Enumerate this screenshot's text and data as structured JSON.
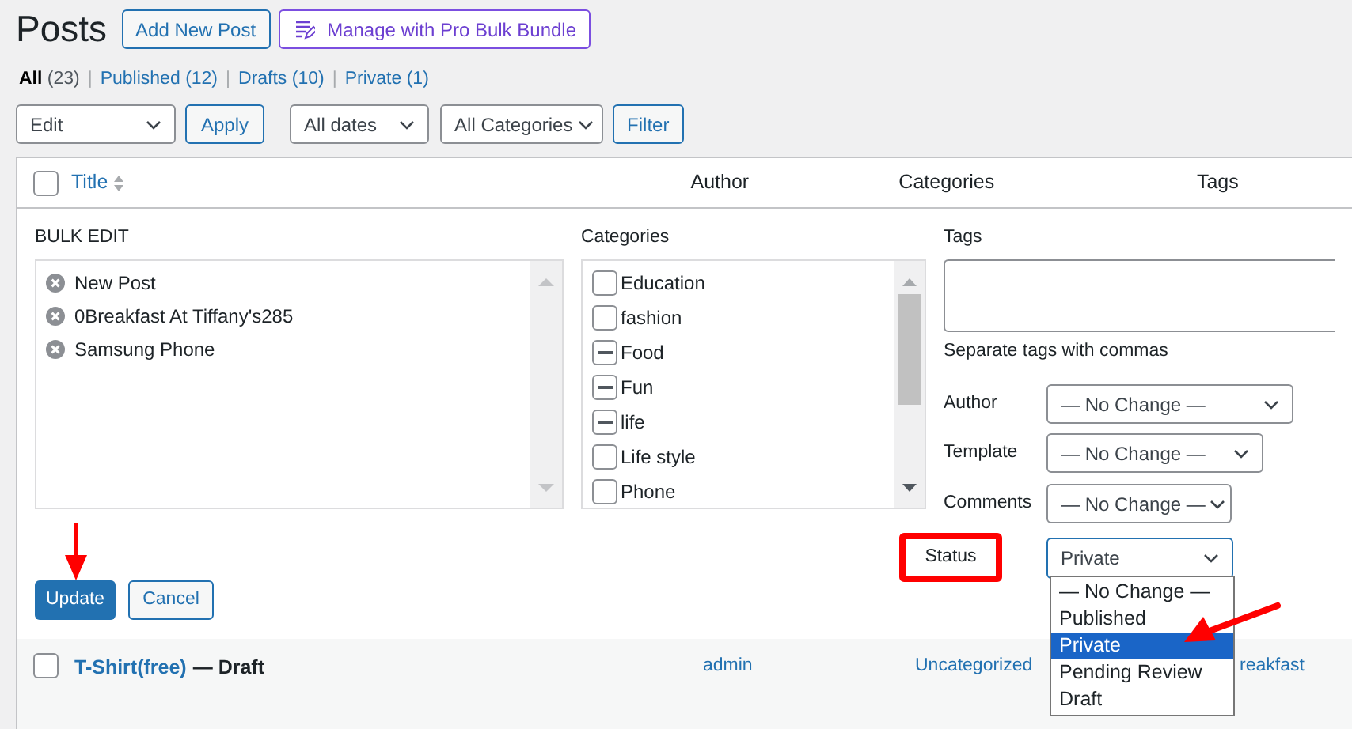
{
  "header": {
    "title": "Posts",
    "buttons": [
      {
        "label": "Add New Post",
        "kind": "default"
      },
      {
        "label": "Manage with Pro Bulk Bundle",
        "kind": "pro"
      }
    ]
  },
  "views": [
    {
      "label": "All",
      "count": "(23)",
      "selected": true
    },
    {
      "label": "Published",
      "count": "(12)",
      "selected": false
    },
    {
      "label": "Drafts",
      "count": "(10)",
      "selected": false
    },
    {
      "label": "Private",
      "count": "(1)",
      "selected": false
    }
  ],
  "view_separator": "|",
  "toolbar": {
    "bulk_action": "Edit",
    "apply": "Apply",
    "dates": "All dates",
    "categories": "All Categories",
    "filter": "Filter"
  },
  "table": {
    "select_all_checked": false,
    "columns": [
      "Title",
      "Author",
      "Categories",
      "Tags"
    ],
    "bulk_edit": {
      "heading": "BULK EDIT",
      "posts": [
        "New Post",
        "0Breakfast At Tiffany's285",
        "Samsung Phone"
      ],
      "categories_label": "Categories",
      "categories": [
        {
          "label": "Education",
          "indeterminate": false
        },
        {
          "label": "fashion",
          "indeterminate": false
        },
        {
          "label": "Food",
          "indeterminate": true
        },
        {
          "label": "Fun",
          "indeterminate": true
        },
        {
          "label": "life",
          "indeterminate": true
        },
        {
          "label": "Life style",
          "indeterminate": false
        },
        {
          "label": "Phone",
          "indeterminate": false
        }
      ],
      "tags_label": "Tags",
      "tags_hint": "Separate tags with commas",
      "fields": [
        {
          "label": "Author",
          "value": "— No Change —",
          "expanded": false
        },
        {
          "label": "Template",
          "value": "— No Change —",
          "expanded": false
        },
        {
          "label": "Comments",
          "value": "— No Change —",
          "expanded": false
        },
        {
          "label": "Status",
          "value": "Private",
          "expanded": true,
          "options": [
            {
              "label": "— No Change —",
              "selected": false
            },
            {
              "label": "Published",
              "selected": false
            },
            {
              "label": "Private",
              "selected": true
            },
            {
              "label": "Pending Review",
              "selected": false
            },
            {
              "label": "Draft",
              "selected": false
            }
          ]
        }
      ],
      "update": "Update",
      "cancel": "Cancel"
    },
    "rows": [
      {
        "checked": false,
        "title": "T-Shirt(free)",
        "state": "— Draft",
        "author": "admin",
        "categories": "Uncategorized",
        "tags": "reakfast"
      }
    ]
  }
}
